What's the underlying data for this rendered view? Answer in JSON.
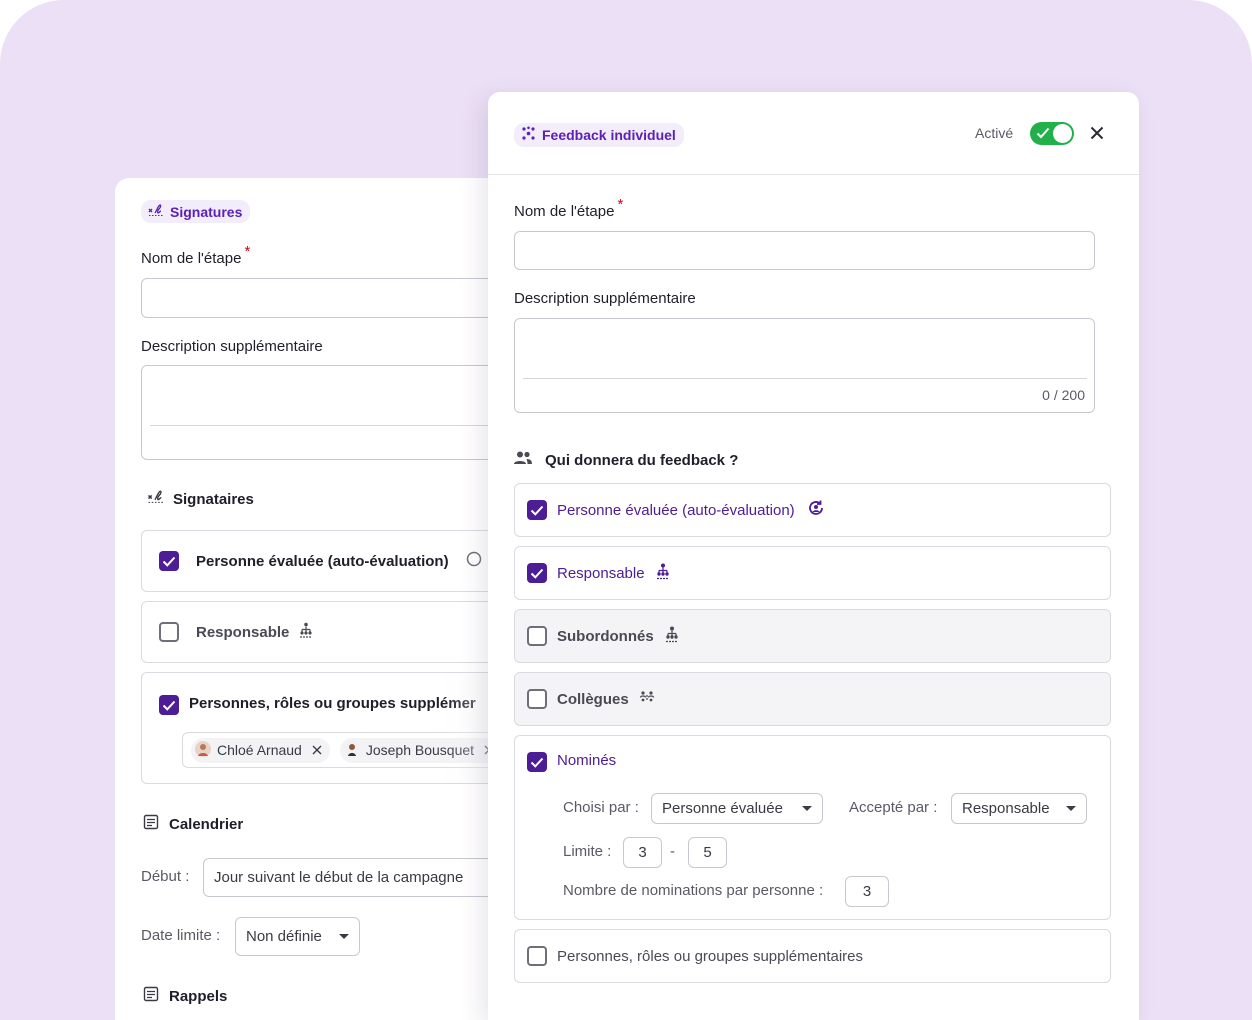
{
  "back_panel": {
    "chip_label": "Signatures",
    "step_name_label": "Nom de l'étape",
    "required_mark": "*",
    "description_label": "Description supplémentaire",
    "signers_title": "Signataires",
    "options": [
      {
        "label": "Personne évaluée (auto-évaluation)",
        "checked": true
      },
      {
        "label": "Responsable",
        "checked": false
      },
      {
        "label": "Personnes, rôles ou groupes supplémer",
        "checked": true
      }
    ],
    "people": [
      {
        "name": "Chloé Arnaud"
      },
      {
        "name": "Joseph Bousquet"
      }
    ],
    "calendar_title": "Calendrier",
    "start_label": "Début :",
    "start_value": "Jour suivant le début de la campagne",
    "deadline_label": "Date limite :",
    "deadline_value": "Non définie",
    "reminders_title": "Rappels"
  },
  "front_panel": {
    "chip_label": "Feedback individuel",
    "active_label": "Activé",
    "active": true,
    "step_name_label": "Nom de l'étape",
    "required_mark": "*",
    "description_label": "Description supplémentaire",
    "char_count": "0 / 200",
    "who_title": "Qui donnera du feedback ?",
    "options": [
      {
        "label": "Personne évaluée (auto-évaluation)",
        "checked": true
      },
      {
        "label": "Responsable",
        "checked": true
      },
      {
        "label": "Subordonnés",
        "checked": false
      },
      {
        "label": "Collègues",
        "checked": false
      },
      {
        "label": "Nominés",
        "checked": true
      },
      {
        "label": "Personnes, rôles ou groupes supplémentaires",
        "checked": false
      }
    ],
    "nominees": {
      "chosen_by_label": "Choisi par :",
      "chosen_by_value": "Personne évaluée",
      "accepted_by_label": "Accepté par :",
      "accepted_by_value": "Responsable",
      "limit_label": "Limite :",
      "limit_min": "3",
      "limit_sep": "-",
      "limit_max": "5",
      "per_person_label": "Nombre de nominations par personne :",
      "per_person_value": "3"
    }
  },
  "colors": {
    "background": "#ece0f6",
    "accent": "#4c1d95",
    "toggle": "#22b04b",
    "required": "#d0021b"
  }
}
